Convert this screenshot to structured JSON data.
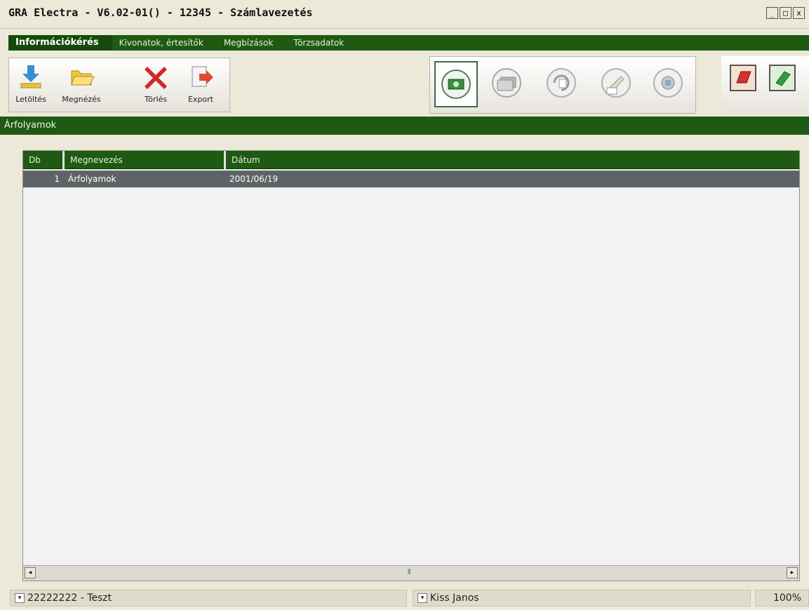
{
  "window": {
    "title": "GRA Electra - V6.02-01() - 12345 - Számlavezetés",
    "controls": [
      "_",
      "□",
      "x"
    ]
  },
  "menu": {
    "items": [
      {
        "label": "Információkérés",
        "active": true
      },
      {
        "label": "Kivonatok, értesítők",
        "active": false
      },
      {
        "label": "Megbízások",
        "active": false
      },
      {
        "label": "Törzsadatok",
        "active": false
      }
    ]
  },
  "toolbar": {
    "download_label": "Letöltés",
    "view_label": "Megnézés",
    "delete_label": "Törlés",
    "export_label": "Export",
    "round_icons": [
      "money-exchange-icon",
      "cards-icon",
      "refresh-doc-icon",
      "signature-icon",
      "settings-icon"
    ],
    "book_icons": [
      "red-book-icon",
      "green-book-icon"
    ]
  },
  "section": {
    "title": "Árfolyamok"
  },
  "grid": {
    "columns": [
      "Db",
      "Megnevezés",
      "Dátum"
    ],
    "rows": [
      {
        "db": "1",
        "name": "Árfolyamok",
        "date": "2001/06/19"
      }
    ]
  },
  "status": {
    "account": "22222222 - Teszt",
    "user": "Kiss Janos",
    "zoom": "100%"
  },
  "colors": {
    "accent_green": "#1e5a12",
    "selected_row": "#5e6466"
  }
}
